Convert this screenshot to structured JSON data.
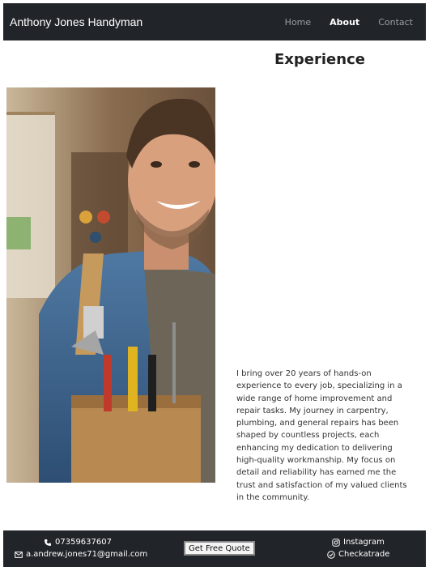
{
  "nav": {
    "brand": "Anthony Jones Handyman",
    "links": [
      "Home",
      "About",
      "Contact"
    ],
    "active": "About"
  },
  "main": {
    "title": "Experience",
    "paragraph": "I bring over 20 years of hands-on experience to every job, specializing in a wide range of home improvement and repair tasks. My journey in carpentry, plumbing, and general repairs has been shaped by countless projects, each enhancing my dedication to delivering high-quality workmanship. My focus on detail and reliability has earned me the trust and satisfaction of my valued clients in the community."
  },
  "footer": {
    "phone": "07359637607",
    "email": "a.andrew.jones71@gmail.com",
    "quote_button": "Get Free Quote",
    "instagram": "Instagram",
    "checkatrade": "Checkatrade"
  },
  "colors": {
    "navbar_bg": "#212529",
    "nav_link": "#9a9ea3",
    "nav_active": "#ffffff"
  },
  "icons": [
    "phone-icon",
    "envelope-icon",
    "instagram-icon",
    "check-circle-icon"
  ]
}
